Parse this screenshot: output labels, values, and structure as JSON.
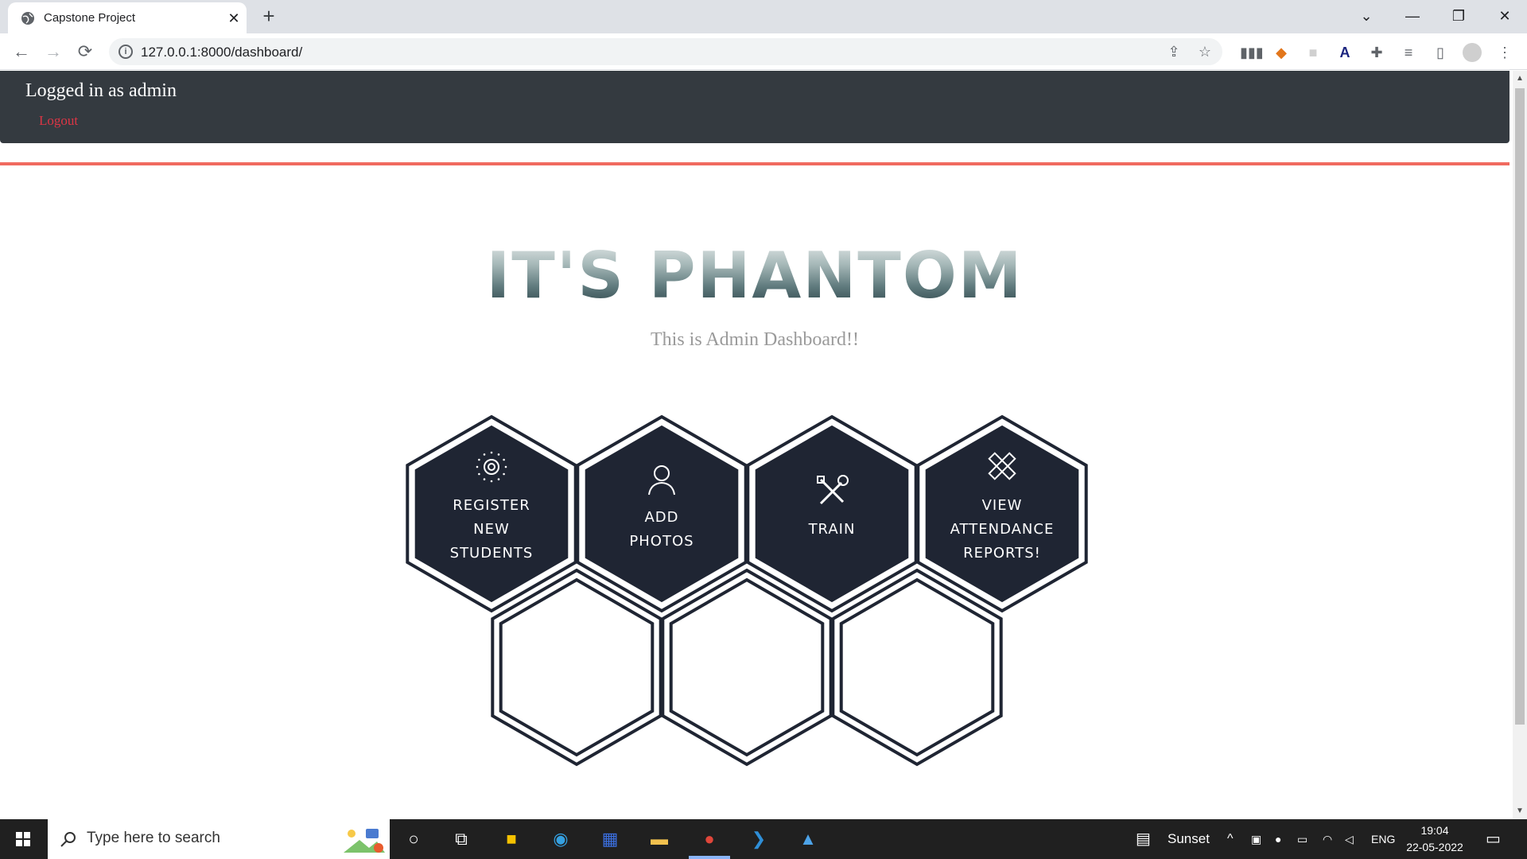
{
  "browser": {
    "tab_title": "Capstone Project",
    "tab_close": "✕",
    "new_tab": "+",
    "url": "127.0.0.1:8000/dashboard/",
    "window_controls": {
      "list": "⌄",
      "minimize": "—",
      "restore": "❐",
      "close": "✕"
    },
    "nav": {
      "back": "←",
      "forward": "→",
      "reload": "⟳"
    },
    "extensions": [
      "bars-ext-icon",
      "metamask-fox-icon",
      "blank-ext-icon",
      "font-ext-icon",
      "puzzle-icon",
      "reading-list-icon",
      "side-panel-icon",
      "profile-avatar",
      "menu-kebab-icon"
    ]
  },
  "header": {
    "logged_in": "Logged in as admin",
    "logout": "Logout"
  },
  "hero": {
    "brand": "IT'S PHANTOM",
    "subtitle": "This is Admin Dashboard!!"
  },
  "tiles": [
    {
      "lines": [
        "REGISTER",
        "NEW",
        "STUDENTS"
      ],
      "icon": "camera-icon"
    },
    {
      "lines": [
        "ADD",
        "PHOTOS"
      ],
      "icon": "user-icon"
    },
    {
      "lines": [
        "TRAIN"
      ],
      "icon": "tools-icon"
    },
    {
      "lines": [
        "VIEW",
        "ATTENDANCE",
        "REPORTS!"
      ],
      "icon": "pencil-ruler-icon"
    }
  ],
  "empty_tiles": 3,
  "taskbar": {
    "search_placeholder": "Type here to search",
    "weather": "Sunset",
    "language": "ENG",
    "time": "19:04",
    "date": "22-05-2022"
  },
  "colors": {
    "navbar": "#343a40",
    "logout": "#dc3545",
    "accent_line": "#f06a5f",
    "hex_fill": "#1f2533",
    "hex_border": "#1f2533"
  }
}
